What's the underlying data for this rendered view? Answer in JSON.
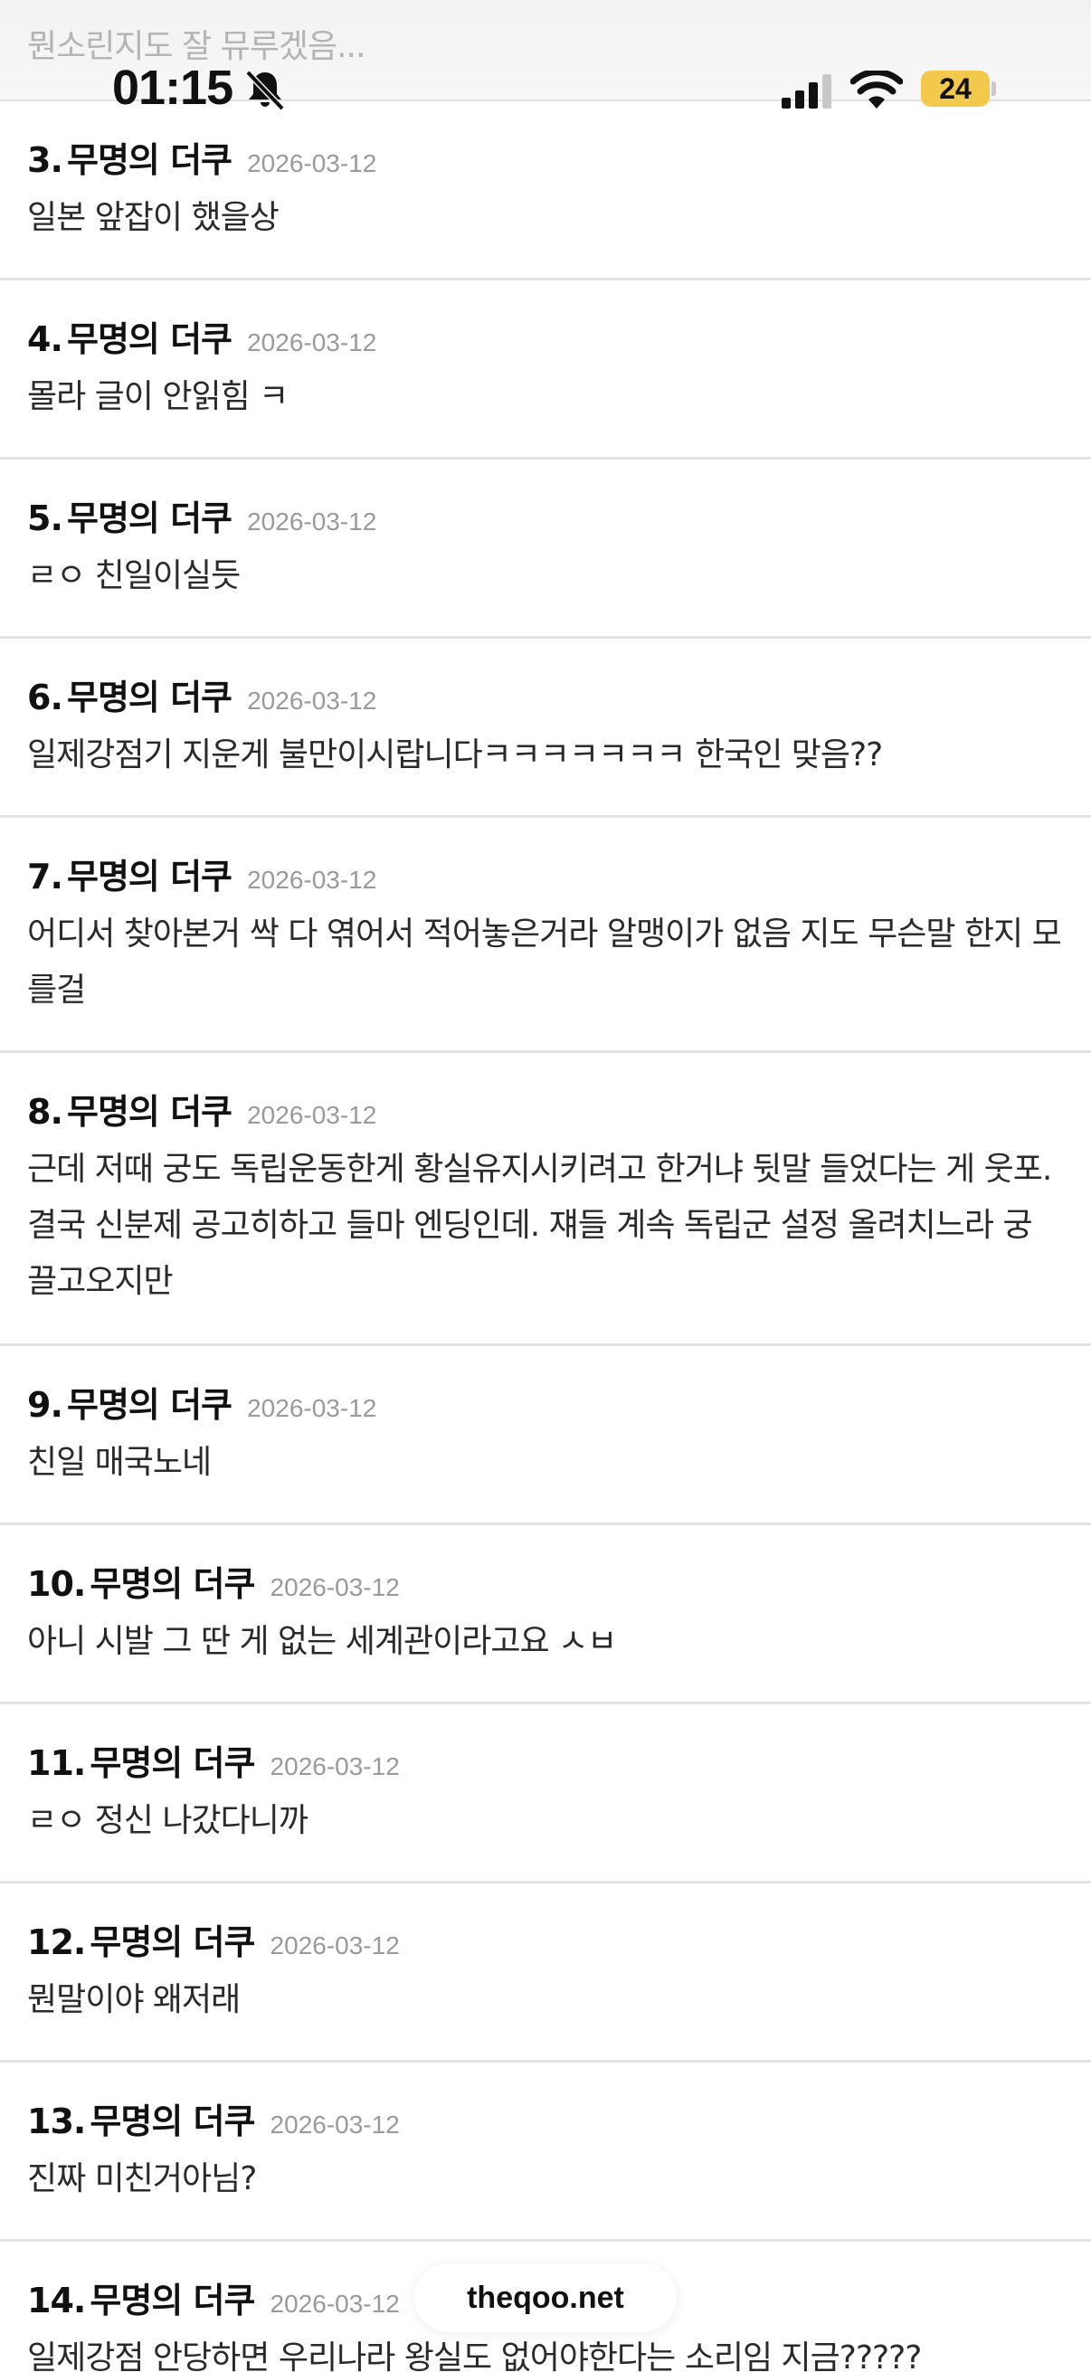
{
  "header": {
    "ghost_title": "뭔소린지도 잘 뮤루겠음...",
    "time": "01:15",
    "battery": "24"
  },
  "comments": [
    {
      "num": "3.",
      "author": "무명의 더쿠",
      "date": "2026-03-12",
      "text": "일본 앞잡이 했을상"
    },
    {
      "num": "4.",
      "author": "무명의 더쿠",
      "date": "2026-03-12",
      "text": "몰라 글이 안읽힘 ㅋ"
    },
    {
      "num": "5.",
      "author": "무명의 더쿠",
      "date": "2026-03-12",
      "text": "ㄹㅇ 친일이실듯"
    },
    {
      "num": "6.",
      "author": "무명의 더쿠",
      "date": "2026-03-12",
      "text": "일제강점기 지운게 불만이시랍니다ㅋㅋㅋㅋㅋㅋㅋ 한국인 맞음??"
    },
    {
      "num": "7.",
      "author": "무명의 더쿠",
      "date": "2026-03-12",
      "text": "어디서 찾아본거 싹 다 엮어서 적어놓은거라 알맹이가 없음 지도 무슨말 한지 모를걸"
    },
    {
      "num": "8.",
      "author": "무명의 더쿠",
      "date": "2026-03-12",
      "text": "근데 저때 궁도 독립운동한게 황실유지시키려고 한거냐 뒷말 들었다는 게 웃포. 결국 신분제 공고히하고 들마 엔딩인데. 쟤들 계속 독립군 설정 올려치느라 궁 끌고오지만"
    },
    {
      "num": "9.",
      "author": "무명의 더쿠",
      "date": "2026-03-12",
      "text": "친일 매국노네"
    },
    {
      "num": "10.",
      "author": "무명의 더쿠",
      "date": "2026-03-12",
      "text": "아니 시발 그 딴 게 없는 세계관이라고요 ㅅㅂ"
    },
    {
      "num": "11.",
      "author": "무명의 더쿠",
      "date": "2026-03-12",
      "text": "ㄹㅇ 정신 나갔다니까"
    },
    {
      "num": "12.",
      "author": "무명의 더쿠",
      "date": "2026-03-12",
      "text": "뭔말이야 왜저래"
    },
    {
      "num": "13.",
      "author": "무명의 더쿠",
      "date": "2026-03-12",
      "text": "진짜 미친거아님?"
    },
    {
      "num": "14.",
      "author": "무명의 더쿠",
      "date": "2026-03-12",
      "text": "일제강점 안당하면 우리나라 왕실도 없어야한다는 소리임 지금?????"
    }
  ],
  "site_badge": "theqoo.net",
  "icons": [
    "bell-slash-icon",
    "cellular-signal-icon",
    "wifi-icon",
    "battery-icon"
  ]
}
